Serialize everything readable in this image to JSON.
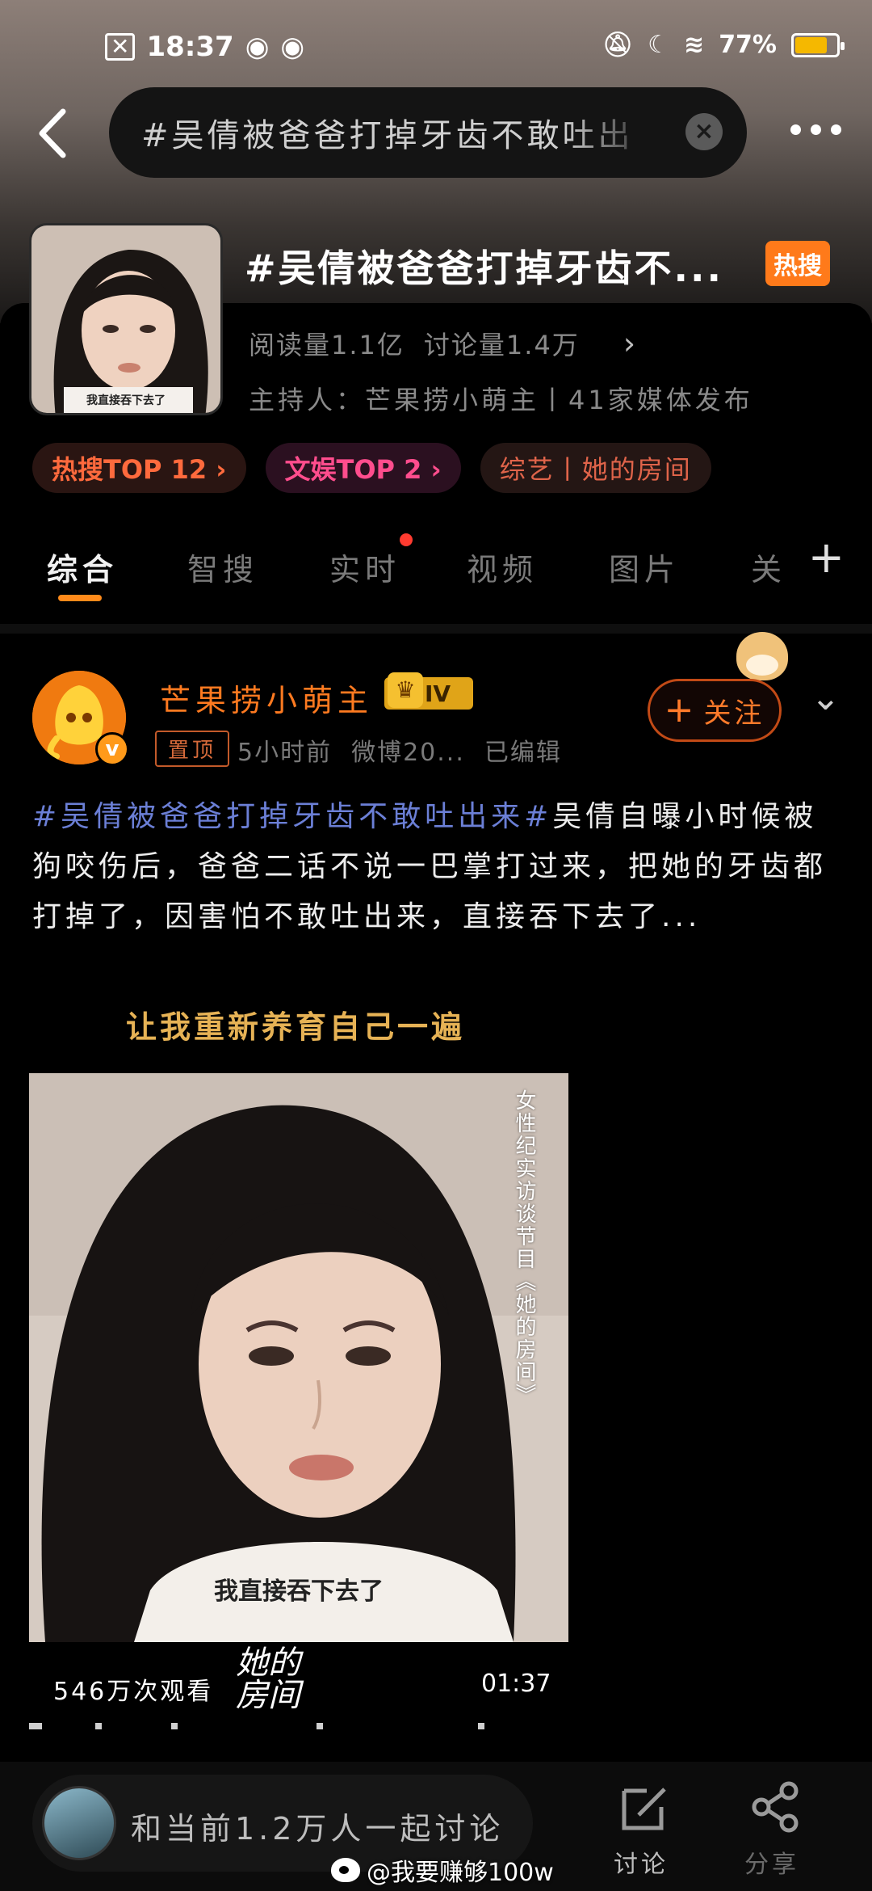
{
  "status_bar": {
    "time": "18:37",
    "battery_percent": "77%",
    "battery_level": 0.77
  },
  "search": {
    "query": "#吴倩被爸爸打掉牙齿不敢吐出"
  },
  "topic": {
    "title": "#吴倩被爸爸打掉牙齿不...",
    "hot_badge": "热搜",
    "reads": "阅读量1.1亿",
    "discussions": "讨论量1.4万",
    "host": "主持人：芒果捞小萌主丨41家媒体发布",
    "thumb_caption": "我直接吞下去了"
  },
  "chips": [
    {
      "label": "热搜TOP 12 ›"
    },
    {
      "label": "文娱TOP 2 ›"
    },
    {
      "label": "综艺丨她的房间"
    }
  ],
  "tabs": [
    {
      "label": "综合"
    },
    {
      "label": "智搜"
    },
    {
      "label": "实时"
    },
    {
      "label": "视频"
    },
    {
      "label": "图片"
    },
    {
      "label": "关"
    }
  ],
  "post": {
    "author": "芒果捞小萌主",
    "level": "IV",
    "pinned": "置顶",
    "time": "5小时前",
    "source": "微博20...",
    "edited": "已编辑",
    "follow_label": "关注",
    "hashtag": "#吴倩被爸爸打掉牙齿不敢吐出来#",
    "text": "吴倩自曝小时候被狗咬伤后，爸爸二话不说一巴掌打过来，把她的牙齿都打掉了，因害怕不敢吐出来，直接吞下去了...",
    "image_caption": "让我重新养育自己一遍"
  },
  "video": {
    "side_text": "女性纪实访谈节目《她的房间》",
    "subtitle": "我直接吞下去了",
    "views": "546万次观看",
    "duration": "01:37",
    "show_logo": "她的房间"
  },
  "bottom": {
    "discuss_prompt": "和当前1.2万人一起讨论",
    "discuss_label": "讨论",
    "share_label": "分享",
    "watermark": "@我要赚够100w"
  }
}
